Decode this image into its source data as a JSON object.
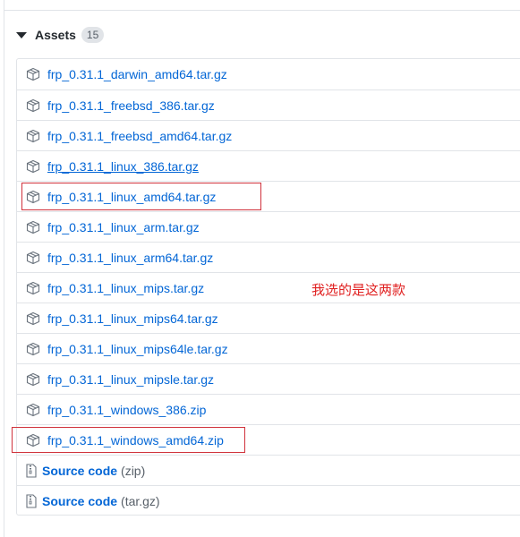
{
  "assets": {
    "title": "Assets",
    "count": "15",
    "files": [
      "frp_0.31.1_darwin_amd64.tar.gz",
      "frp_0.31.1_freebsd_386.tar.gz",
      "frp_0.31.1_freebsd_amd64.tar.gz",
      "frp_0.31.1_linux_386.tar.gz",
      "frp_0.31.1_linux_amd64.tar.gz",
      "frp_0.31.1_linux_arm.tar.gz",
      "frp_0.31.1_linux_arm64.tar.gz",
      "frp_0.31.1_linux_mips.tar.gz",
      "frp_0.31.1_linux_mips64.tar.gz",
      "frp_0.31.1_linux_mips64le.tar.gz",
      "frp_0.31.1_linux_mipsle.tar.gz",
      "frp_0.31.1_windows_386.zip",
      "frp_0.31.1_windows_amd64.zip"
    ],
    "source": [
      {
        "label": "Source code",
        "ext": "(zip)"
      },
      {
        "label": "Source code",
        "ext": "(tar.gz)"
      }
    ]
  },
  "annotation": {
    "text": "我选的是这两款"
  },
  "colors": {
    "link": "#0366d6",
    "annotation": "#e02020",
    "highlight": "#d0323c"
  },
  "icons": {
    "file": "package-icon",
    "source": "file-zip-icon",
    "toggle": "triangle-down-icon"
  }
}
